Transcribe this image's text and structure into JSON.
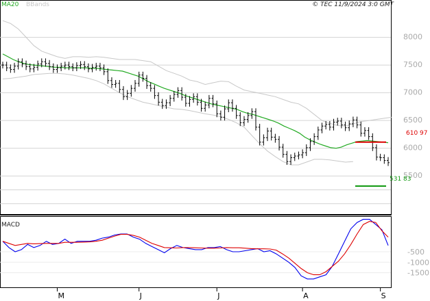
{
  "header": {
    "ma_label": "MA20",
    "bb_label": "BBands",
    "source": "© TEC 11/9/2024 3:0 GMT"
  },
  "colors": {
    "ma": "#22aa22",
    "bbands": "#c8c8c8",
    "price_bars": "#000000",
    "macd": "#0000ee",
    "signal": "#dd0000",
    "resistance": "#dd0000",
    "support": "#119911",
    "grid": "#d4d4d4",
    "axis_text": "#aaaaaa"
  },
  "levels": {
    "resistance": {
      "value": 6109.7,
      "label": "610 97"
    },
    "support": {
      "value": 5318.3,
      "label": "531 83"
    }
  },
  "chart_data": [
    {
      "type": "ohlc",
      "title": "",
      "ylim": [
        4800,
        8500
      ],
      "y_ticks": [
        5500,
        6000,
        6500,
        7000,
        7500,
        8000
      ],
      "y_tick_labels": [
        "5500",
        "6000",
        "6500",
        "7000",
        "7500",
        "8000"
      ],
      "x_tick_labels": [
        "M",
        "J",
        "J",
        "A",
        "S"
      ],
      "x_tick_index": [
        14,
        35,
        55,
        77,
        97
      ],
      "grid": true,
      "close": [
        7500,
        7450,
        7420,
        7480,
        7560,
        7520,
        7470,
        7430,
        7460,
        7520,
        7560,
        7530,
        7470,
        7420,
        7450,
        7480,
        7500,
        7470,
        7450,
        7490,
        7510,
        7470,
        7430,
        7460,
        7480,
        7450,
        7380,
        7220,
        7150,
        7170,
        7060,
        6930,
        6990,
        7080,
        7170,
        7320,
        7260,
        7130,
        7080,
        6950,
        6830,
        6770,
        6820,
        6900,
        6970,
        7040,
        6920,
        6810,
        6880,
        6930,
        6830,
        6720,
        6780,
        6900,
        6800,
        6620,
        6560,
        6710,
        6820,
        6720,
        6590,
        6460,
        6520,
        6590,
        6660,
        6380,
        6110,
        6190,
        6310,
        6200,
        6160,
        6020,
        5890,
        5760,
        5830,
        5860,
        5880,
        5920,
        6010,
        6120,
        6210,
        6330,
        6400,
        6430,
        6380,
        6470,
        6490,
        6420,
        6370,
        6440,
        6510,
        6420,
        6270,
        6320,
        6210,
        6010,
        5840,
        5830,
        5780,
        5740
      ],
      "ma20": [
        7700,
        7650,
        7600,
        7560,
        7530,
        7510,
        7500,
        7490,
        7480,
        7470,
        7460,
        7460,
        7450,
        7450,
        7450,
        7450,
        7450,
        7440,
        7440,
        7430,
        7420,
        7410,
        7400,
        7390,
        7360,
        7330,
        7300,
        7250,
        7200,
        7160,
        7120,
        7080,
        7050,
        7020,
        6990,
        6950,
        6920,
        6890,
        6860,
        6830,
        6800,
        6780,
        6760,
        6740,
        6720,
        6700,
        6660,
        6630,
        6610,
        6580,
        6550,
        6520,
        6490,
        6450,
        6400,
        6360,
        6320,
        6270,
        6200,
        6150,
        6110,
        6070,
        6040,
        6010,
        6000,
        6020,
        6060,
        6090,
        6120,
        6130,
        6140,
        6130,
        6120,
        6110,
        6100
      ],
      "ma20_start_index": 0,
      "bb_upper": [
        8300,
        8250,
        8150,
        8000,
        7850,
        7750,
        7700,
        7650,
        7620,
        7650,
        7650,
        7640,
        7650,
        7640,
        7620,
        7600,
        7600,
        7600,
        7580,
        7560,
        7480,
        7400,
        7350,
        7300,
        7230,
        7200,
        7150,
        7180,
        7210,
        7200,
        7120,
        7050,
        7020,
        6990,
        6960,
        6930,
        6880,
        6830,
        6800,
        6720,
        6610,
        6500,
        6450,
        6410,
        6400,
        6440,
        6480,
        6500,
        6520,
        6540,
        6550,
        6560
      ],
      "bb_upper_index": [
        0,
        2,
        4,
        6,
        8,
        10,
        12,
        14,
        16,
        18,
        20,
        22,
        24,
        26,
        28,
        30,
        32,
        34,
        36,
        38,
        40,
        42,
        44,
        46,
        48,
        50,
        52,
        54,
        56,
        58,
        60,
        62,
        64,
        66,
        68,
        70,
        72,
        74,
        76,
        78,
        80,
        82,
        84,
        86,
        88,
        90,
        92,
        94,
        96,
        98,
        99,
        100
      ],
      "bb_lower": [
        7250,
        7260,
        7280,
        7300,
        7330,
        7340,
        7350,
        7350,
        7340,
        7320,
        7290,
        7260,
        7220,
        7160,
        7080,
        7000,
        6930,
        6880,
        6830,
        6800,
        6770,
        6740,
        6710,
        6700,
        6680,
        6650,
        6620,
        6600,
        6570,
        6520,
        6460,
        6380,
        6230,
        6080,
        5950,
        5850,
        5760,
        5700,
        5700,
        5750,
        5800,
        5800,
        5790,
        5770,
        5750,
        5760
      ],
      "bb_lower_index": [
        0,
        2,
        4,
        6,
        8,
        10,
        12,
        14,
        16,
        18,
        20,
        22,
        24,
        26,
        28,
        30,
        32,
        34,
        36,
        38,
        40,
        42,
        44,
        46,
        48,
        50,
        52,
        54,
        56,
        58,
        60,
        62,
        64,
        66,
        68,
        70,
        72,
        74,
        76,
        78,
        80,
        82,
        84,
        86,
        88,
        90
      ]
    },
    {
      "type": "line",
      "title": "MACD",
      "ylim": [
        -2200,
        1200
      ],
      "y_ticks": [
        -500,
        -1000,
        -1500
      ],
      "y_tick_labels": [
        "-500",
        "-1000",
        "-1500"
      ],
      "series": [
        {
          "name": "",
          "values": [
            0,
            -300,
            -500,
            -400,
            -150,
            -300,
            -200,
            0,
            -150,
            -100,
            100,
            -100,
            0,
            0,
            0,
            50,
            150,
            200,
            300,
            350,
            350,
            200,
            100,
            -100,
            -250,
            -400,
            -550,
            -350,
            -200,
            -300,
            -350,
            -400,
            -400,
            -300,
            -300,
            -250,
            -400,
            -500,
            -500,
            -450,
            -400,
            -350,
            -500,
            -450,
            -600,
            -800,
            -1000,
            -1250,
            -1650,
            -1800,
            -1800,
            -1700,
            -1600,
            -1200,
            -600,
            0,
            600,
            900,
            1050,
            1050,
            800,
            550,
            -200
          ],
          "x": [
            0,
            2,
            4,
            6,
            8,
            10,
            12,
            14,
            16,
            18,
            20,
            22,
            24,
            26,
            28,
            30,
            32,
            34,
            36,
            38,
            40,
            42,
            44,
            46,
            48,
            50,
            52,
            54,
            56,
            58,
            60,
            62,
            64,
            66,
            68,
            70,
            72,
            74,
            76,
            78,
            80,
            82,
            84,
            86,
            88,
            90,
            92,
            94,
            96,
            98,
            100,
            102,
            104,
            106,
            108,
            110,
            112,
            114,
            116,
            118,
            120,
            122,
            124
          ]
        },
        {
          "name": "",
          "values": [
            0,
            -100,
            -200,
            -150,
            -100,
            -120,
            -110,
            -100,
            -100,
            -100,
            -50,
            -50,
            -50,
            -40,
            -30,
            0,
            50,
            150,
            250,
            330,
            330,
            280,
            200,
            50,
            -100,
            -200,
            -300,
            -310,
            -320,
            -300,
            -300,
            -310,
            -320,
            -330,
            -330,
            -320,
            -300,
            -310,
            -310,
            -330,
            -350,
            -360,
            -360,
            -370,
            -420,
            -600,
            -800,
            -1050,
            -1300,
            -1500,
            -1600,
            -1600,
            -1450,
            -1200,
            -950,
            -600,
            -150,
            350,
            800,
            950,
            900,
            500,
            200
          ],
          "x": [
            0,
            2,
            4,
            6,
            8,
            10,
            12,
            14,
            16,
            18,
            20,
            22,
            24,
            26,
            28,
            30,
            32,
            34,
            36,
            38,
            40,
            42,
            44,
            46,
            48,
            50,
            52,
            54,
            56,
            58,
            60,
            62,
            64,
            66,
            68,
            70,
            72,
            74,
            76,
            78,
            80,
            82,
            84,
            86,
            88,
            90,
            92,
            94,
            96,
            98,
            100,
            102,
            104,
            106,
            108,
            110,
            112,
            114,
            116,
            118,
            120,
            122,
            124
          ]
        }
      ]
    }
  ]
}
